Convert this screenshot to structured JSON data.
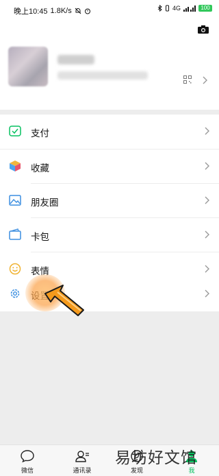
{
  "status_bar": {
    "time": "晚上10:45",
    "speed": "1.8K/s",
    "battery": "100",
    "signal_label": "4G"
  },
  "profile": {
    "camera_icon": "camera-icon",
    "qr_icon": "qr-code-icon"
  },
  "menu": {
    "pay": "支付",
    "favorites": "收藏",
    "moments": "朋友圈",
    "cards": "卡包",
    "stickers": "表情",
    "settings": "设置"
  },
  "tabs": [
    {
      "label": "微信",
      "icon": "chat-icon"
    },
    {
      "label": "通讯录",
      "icon": "contacts-icon"
    },
    {
      "label": "发现",
      "icon": "discover-icon"
    },
    {
      "label": "我",
      "icon": "me-icon"
    }
  ],
  "watermark": "易坊好文馆",
  "colors": {
    "accent": "#07c160",
    "background": "#ededed",
    "highlight": "#f5a047"
  }
}
